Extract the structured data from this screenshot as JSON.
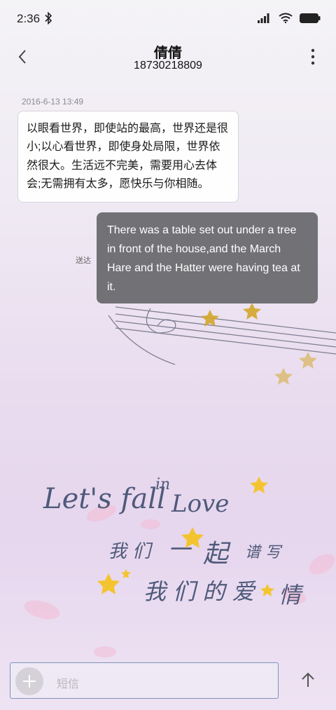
{
  "status_bar": {
    "time": "2:36"
  },
  "header": {
    "contact_name": "倩倩",
    "contact_number": "18730218809"
  },
  "conversation": {
    "timestamp": "2016-6-13 13:49",
    "incoming_message": "以眼看世界，即使站的最高，世界还是很小;以心看世界，即使身处局限，世界依然很大。生活远不完美，需要用心去体会;无需拥有太多，愿快乐与你相随。",
    "outgoing_message": "There was a table set out under a tree in front of the house,and the March Hare and the Hatter were having tea at it.",
    "delivery_status": "送达"
  },
  "wallpaper": {
    "line1": "Let's fall",
    "line1_small": "in",
    "line1_end": "Love",
    "chinese_line1a": "我 们",
    "chinese_line1b": "一",
    "chinese_line1c": "起",
    "chinese_line1d": "谱 写",
    "chinese_line2": "我 们 的 爱",
    "chinese_line2_end": "情"
  },
  "composer": {
    "placeholder": "短信"
  },
  "colors": {
    "outgoing_bubble": "#6c6c70",
    "incoming_bubble": "#ffffff",
    "star": "#f4c430",
    "lettering": "#4f5a7a"
  },
  "icons": [
    "bluetooth-icon",
    "signal-icon",
    "wifi-icon",
    "battery-icon",
    "back-arrow-icon",
    "more-vertical-icon",
    "plus-icon",
    "send-arrow-icon"
  ]
}
